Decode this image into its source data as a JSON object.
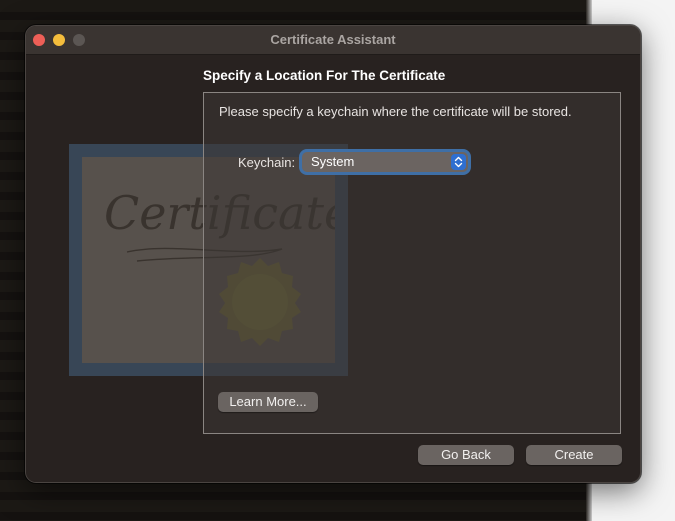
{
  "window": {
    "title": "Certificate Assistant"
  },
  "page": {
    "heading": "Specify a Location For The Certificate",
    "instruction": "Please specify a keychain where the certificate will be stored.",
    "keychain_label": "Keychain:",
    "keychain_value": "System",
    "learn_more": "Learn More...",
    "go_back": "Go Back",
    "create": "Create"
  },
  "illustration": {
    "word": "Certificate",
    "seal_color": "#8a8a4a",
    "paper_color": "#5d5751",
    "frame_color": "#3a4a5c"
  },
  "colors": {
    "accent": "#2f6fd0",
    "focus_ring": "#3f6fa6",
    "close": "#ed5f57",
    "minimize": "#f4bd3c"
  }
}
